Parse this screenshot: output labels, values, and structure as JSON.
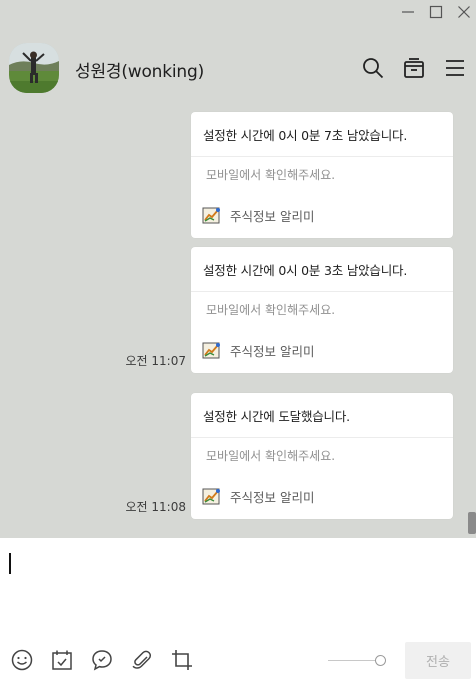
{
  "window": {
    "minimize_icon": "minimize-icon",
    "maximize_icon": "maximize-icon",
    "close_icon": "close-icon"
  },
  "header": {
    "title": "성원경(wonking)",
    "icons": [
      "search-icon",
      "inbox-icon",
      "menu-icon"
    ]
  },
  "messages": [
    {
      "title": "설정한 시간에 0시 0분 7초 남았습니다.",
      "subtitle": "모바일에서 확인해주세요.",
      "app_name": "주식정보 알리미",
      "timestamp": ""
    },
    {
      "title": "설정한 시간에 0시 0분 3초 남았습니다.",
      "subtitle": "모바일에서 확인해주세요.",
      "app_name": "주식정보 알리미",
      "timestamp": "오전 11:07"
    },
    {
      "title": "설정한 시간에 도달했습니다.",
      "subtitle": "모바일에서 확인해주세요.",
      "app_name": "주식정보 알리미",
      "timestamp": "오전 11:08"
    }
  ],
  "input": {
    "value": "",
    "toolbar_icons": [
      "emoji-icon",
      "calendar-icon",
      "chat-bubble-icon",
      "paperclip-icon",
      "crop-icon"
    ],
    "send_label": "전송"
  },
  "colors": {
    "chat_background": "#d6d8d4",
    "card_background": "#ffffff",
    "send_disabled_bg": "#f0f0f0",
    "send_disabled_text": "#b0b0b0"
  }
}
